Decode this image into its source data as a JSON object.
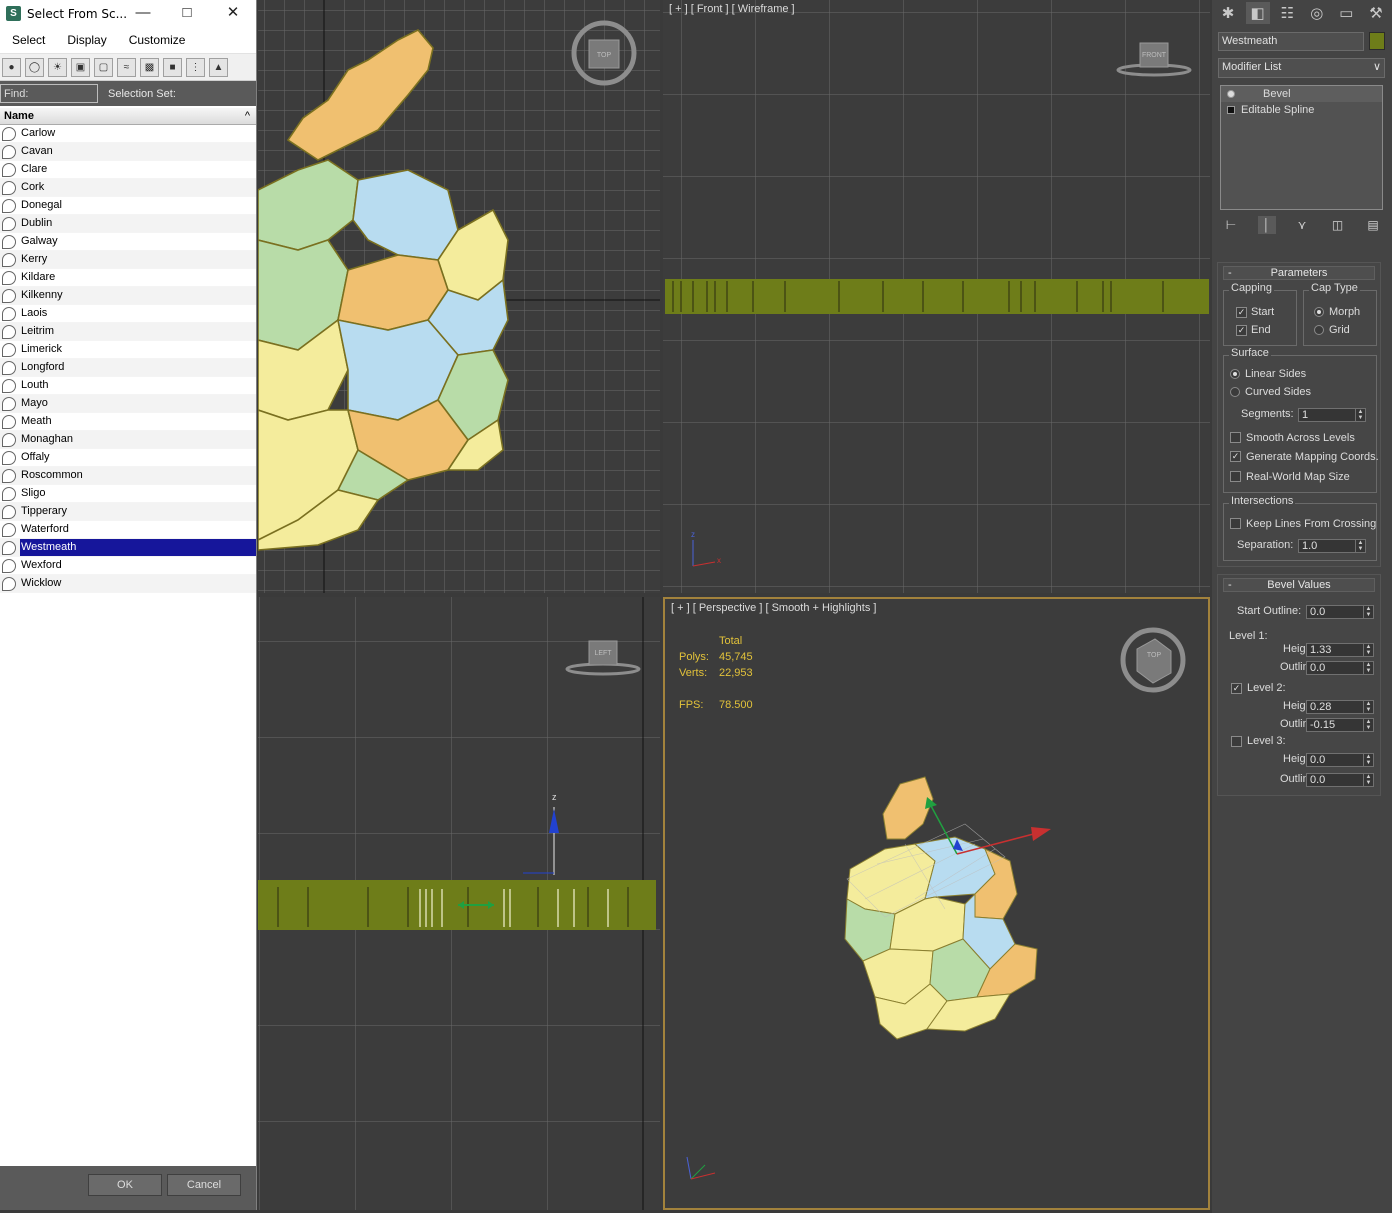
{
  "dialog": {
    "title": "Select From Sc...",
    "menu": [
      "Select",
      "Display",
      "Customize"
    ],
    "find_label": "Find:",
    "find_value": "",
    "selection_set_label": "Selection Set:",
    "column_header": "Name",
    "sort_indicator": "^",
    "items": [
      "Carlow",
      "Cavan",
      "Clare",
      "Cork",
      "Donegal",
      "Dublin",
      "Galway",
      "Kerry",
      "Kildare",
      "Kilkenny",
      "Laois",
      "Leitrim",
      "Limerick",
      "Longford",
      "Louth",
      "Mayo",
      "Meath",
      "Monaghan",
      "Offaly",
      "Roscommon",
      "Sligo",
      "Tipperary",
      "Waterford",
      "Westmeath",
      "Wexford",
      "Wicklow"
    ],
    "selected_item": "Westmeath",
    "ok_label": "OK",
    "cancel_label": "Cancel"
  },
  "viewports": {
    "top": {
      "cube_label": "TOP"
    },
    "front": {
      "label": "[ + ] [ Front ] [ Wireframe ]",
      "cube_label": "FRONT"
    },
    "left": {
      "cube_label": "LEFT"
    },
    "perspective": {
      "label": "[ + ] [ Perspective ] [ Smooth + Highlights ]",
      "stats_header": "Total",
      "polys_label": "Polys:",
      "polys_value": "45,745",
      "verts_label": "Verts:",
      "verts_value": "22,953",
      "fps_label": "FPS:",
      "fps_value": "78.500",
      "cube_label": "TOP"
    }
  },
  "command_panel": {
    "object_name": "Westmeath",
    "object_color": "#6e7d19",
    "modifier_list": "Modifier List",
    "stack": [
      {
        "label": "Bevel",
        "active": true
      },
      {
        "label": "Editable Spline",
        "active": false
      }
    ],
    "parameters": {
      "title": "Parameters",
      "capping_title": "Capping",
      "start_label": "Start",
      "start_checked": true,
      "end_label": "End",
      "end_checked": true,
      "cap_type_title": "Cap Type",
      "morph_label": "Morph",
      "grid_label": "Grid",
      "cap_type_selected": "Morph",
      "surface_title": "Surface",
      "linear_sides_label": "Linear Sides",
      "curved_sides_label": "Curved Sides",
      "surface_selected": "Linear Sides",
      "segments_label": "Segments:",
      "segments_value": "1",
      "smooth_across_label": "Smooth Across Levels",
      "smooth_across_checked": false,
      "gen_mapping_label": "Generate Mapping Coords.",
      "gen_mapping_checked": true,
      "real_world_label": "Real-World Map Size",
      "real_world_checked": false,
      "intersections_title": "Intersections",
      "keep_lines_label": "Keep Lines From Crossing",
      "keep_lines_checked": false,
      "separation_label": "Separation:",
      "separation_value": "1.0"
    },
    "bevel_values": {
      "title": "Bevel Values",
      "start_outline_label": "Start Outline:",
      "start_outline_value": "0.0",
      "level1_label": "Level 1:",
      "level1_height_label": "Height:",
      "level1_height": "1.33",
      "level1_outline_label": "Outline:",
      "level1_outline": "0.0",
      "level2_label": "Level 2:",
      "level2_checked": true,
      "level2_height_label": "Height:",
      "level2_height": "0.28",
      "level2_outline_label": "Outline:",
      "level2_outline": "-0.15",
      "level3_label": "Level 3:",
      "level3_checked": false,
      "level3_height_label": "Height:",
      "level3_height": "0.0",
      "level3_outline_label": "Outline:",
      "level3_outline": "0.0"
    }
  },
  "colors": {
    "accent_viewport_border": "#a2823c",
    "selection_blue": "#16169b",
    "extrusion_green": "#6e7d19",
    "map_orange": "#f0c070",
    "map_green": "#b8dca8",
    "map_blue": "#b8dcf0",
    "map_yellow": "#f4ec9c"
  }
}
